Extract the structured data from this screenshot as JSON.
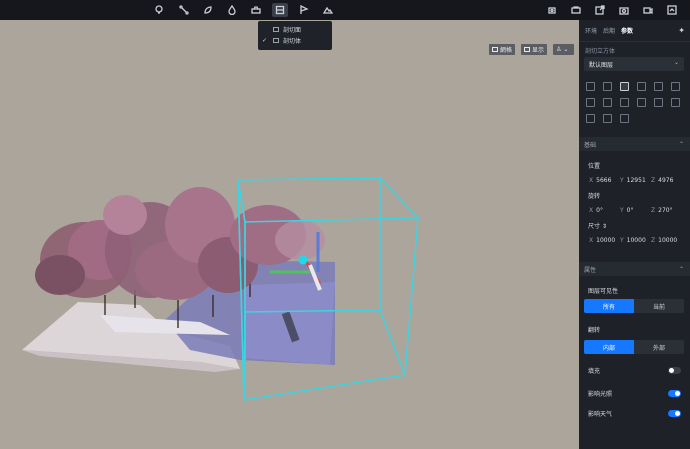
{
  "toolbar": {
    "icons": [
      "lightbulb-icon",
      "path-icon",
      "leaf-icon",
      "fire-icon",
      "vehicle-icon",
      "section-icon",
      "flag-icon",
      "terrain-icon",
      "drone-icon",
      "camera-rig-icon",
      "share-icon",
      "camera-icon",
      "video-icon",
      "export-icon"
    ]
  },
  "dropdown": {
    "items": [
      {
        "label": "剖切面",
        "checked": false
      },
      {
        "label": "剖切体",
        "checked": true
      }
    ]
  },
  "viewport": {
    "grid_label": "網格",
    "display_label": "显示"
  },
  "panel": {
    "tabs": [
      "环境",
      "后期",
      "参数"
    ],
    "active_tab": "参数",
    "title": "剖切立方体",
    "layer_select": "默认图层",
    "sections": {
      "basic": "基础",
      "attributes": "属性"
    },
    "position": {
      "label": "位置",
      "x": "5666",
      "y": "12951",
      "z": "4976"
    },
    "rotation": {
      "label": "旋转",
      "x": "0°",
      "y": "0°",
      "z": "270°"
    },
    "size": {
      "label": "尺寸",
      "x": "10000",
      "y": "10000",
      "z": "10000"
    },
    "layer_visibility": {
      "label": "图层可见性",
      "options": [
        "所有",
        "当前"
      ],
      "selected": "所有"
    },
    "flip": {
      "label": "翻转",
      "options": [
        "内部",
        "外部"
      ],
      "selected": "内部"
    },
    "fill": {
      "label": "填充",
      "on": false
    },
    "affect_light": {
      "label": "影响光照",
      "on": true
    },
    "affect_weather": {
      "label": "影响天气",
      "on": true
    }
  },
  "colors": {
    "accent": "#1677ff",
    "cube": "#3fd3e0",
    "viewport_bg": "#aba59c"
  }
}
